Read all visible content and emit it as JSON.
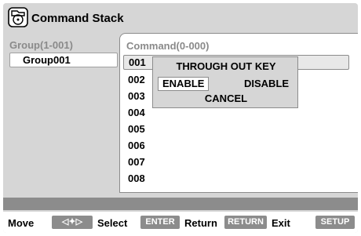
{
  "window": {
    "title": "Command Stack"
  },
  "group": {
    "header": "Group(1-001)",
    "items": [
      {
        "label": "Group001"
      }
    ]
  },
  "command": {
    "header": "Command(0-000)",
    "rows": [
      "001",
      "002",
      "003",
      "004",
      "005",
      "006",
      "007",
      "008"
    ]
  },
  "popup": {
    "title": "THROUGH OUT KEY",
    "enable": "ENABLE",
    "disable": "DISABLE",
    "cancel": "CANCEL"
  },
  "footer": {
    "move_label": "Move",
    "move_key": "◁✦▷",
    "select_label": "Select",
    "select_key": "ENTER",
    "return_label": "Return",
    "return_key": "RETURN",
    "exit_label": "Exit",
    "exit_key": "SETUP"
  }
}
